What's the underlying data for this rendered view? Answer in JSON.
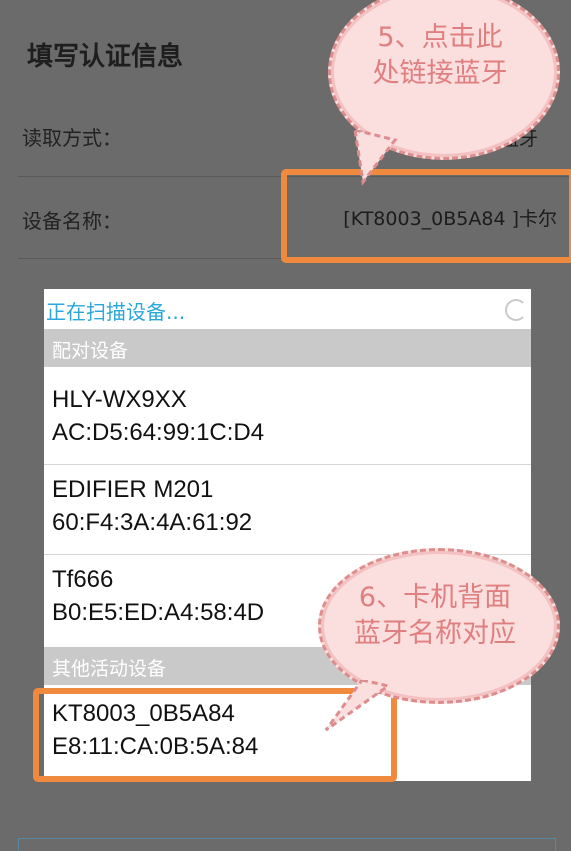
{
  "form": {
    "title": "填写认证信息",
    "read_method_label": "读取方式：",
    "read_method_option": "蓝牙",
    "device_name_label": "设备名称：",
    "device_name_value": "[KT8003_0B5A84 ]卡尔"
  },
  "dialog": {
    "title": "正在扫描设备...",
    "paired_header": "配对设备",
    "other_header": "其他活动设备",
    "paired_devices": [
      {
        "name": "HLY-WX9XX",
        "mac": "AC:D5:64:99:1C:D4"
      },
      {
        "name": "EDIFIER M201",
        "mac": "60:F4:3A:4A:61:92"
      },
      {
        "name": "Tf666",
        "mac": "B0:E5:ED:A4:58:4D"
      }
    ],
    "other_devices": [
      {
        "name": "KT8003_0B5A84",
        "mac": "E8:11:CA:0B:5A:84"
      }
    ]
  },
  "annotations": {
    "bubble_top": "5、点击此处链接蓝牙",
    "bubble_bottom": "6、卡机背面蓝牙名称对应",
    "highlight_color": "#f08a3f",
    "bubble_color": "#fbdede"
  }
}
